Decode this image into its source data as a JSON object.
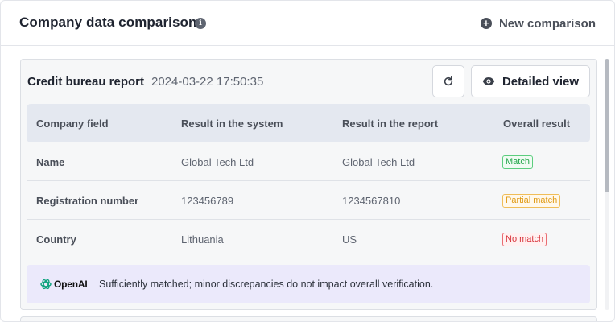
{
  "header": {
    "title": "Company data comparison",
    "info_icon": "info-icon",
    "new_comparison_label": "New comparison",
    "new_comparison_icon": "plus-circle-icon"
  },
  "report": {
    "title": "Credit bureau report",
    "timestamp": "2024-03-22 17:50:35",
    "refresh_icon": "refresh-icon",
    "detail_icon": "eye-icon",
    "detail_label": "Detailed view",
    "columns": [
      "Company field",
      "Result in the system",
      "Result in the report",
      "Overall result"
    ],
    "rows": [
      {
        "field": "Name",
        "system": "Global Tech Ltd",
        "report": "Global Tech Ltd",
        "result": "Match",
        "status": "match"
      },
      {
        "field": "Registration number",
        "system": "123456789",
        "report": "1234567810",
        "result": "Partial match",
        "status": "partial"
      },
      {
        "field": "Country",
        "system": "Lithuania",
        "report": "US",
        "result": "No match",
        "status": "no"
      }
    ],
    "ai": {
      "logo_text": "OpenAI",
      "summary": "Sufficiently matched; minor discrepancies do not impact overall verification."
    }
  },
  "colors": {
    "match": "#22a64a",
    "partial": "#e09a14",
    "no_match": "#d8333b",
    "ai_background": "#ebe9fb"
  }
}
